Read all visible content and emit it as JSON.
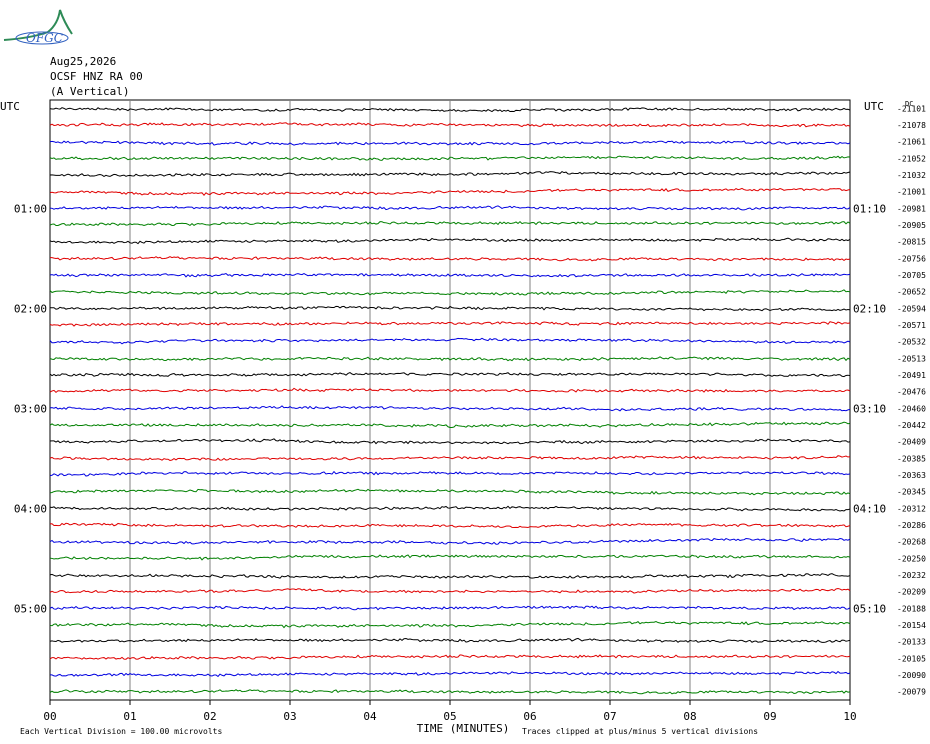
{
  "logo": {
    "text": "OFGC"
  },
  "header": {
    "date": "Aug25,2026",
    "station": "OCSF HNZ RA 00",
    "component": "(A Vertical)"
  },
  "axes": {
    "left_title": "UTC",
    "right_title": "UTC",
    "dc_label": "DC",
    "x_title": "TIME (MINUTES)",
    "x_ticks": [
      "00",
      "01",
      "02",
      "03",
      "04",
      "05",
      "06",
      "07",
      "08",
      "09",
      "10"
    ]
  },
  "footer": {
    "scale_note": "Each Vertical Division =  100.00 microvolts",
    "clip_note": "Traces clipped at plus/minus 5 vertical divisions"
  },
  "colors": {
    "cycle": [
      "#000000",
      "#e00000",
      "#0000e0",
      "#008000"
    ],
    "grid": "#808080"
  },
  "chart_data": {
    "type": "line",
    "title": "OCSF HNZ RA 00 (A Vertical)",
    "xlabel": "TIME (MINUTES)",
    "xlim": [
      0,
      10
    ],
    "left_time_labels": [
      {
        "row": 6,
        "text": "01:00"
      },
      {
        "row": 12,
        "text": "02:00"
      },
      {
        "row": 18,
        "text": "03:00"
      },
      {
        "row": 24,
        "text": "04:00"
      },
      {
        "row": 30,
        "text": "05:00"
      }
    ],
    "right_time_labels": [
      {
        "row": 6,
        "text": "01:10"
      },
      {
        "row": 12,
        "text": "02:10"
      },
      {
        "row": 18,
        "text": "03:10"
      },
      {
        "row": 24,
        "text": "04:10"
      },
      {
        "row": 30,
        "text": "05:10"
      }
    ],
    "dc_offsets": [
      "-21101",
      "-21078",
      "-21061",
      "-21052",
      "-21032",
      "-21001",
      "-20981",
      "-20905",
      "-20815",
      "-20756",
      "-20705",
      "-20652",
      "-20594",
      "-20571",
      "-20532",
      "-20513",
      "-20491",
      "-20476",
      "-20460",
      "-20442",
      "-20409",
      "-20385",
      "-20363",
      "-20345",
      "-20312",
      "-20286",
      "-20268",
      "-20250",
      "-20232",
      "-20209",
      "-20188",
      "-20154",
      "-20133",
      "-20105",
      "-20090",
      "-20079"
    ]
  }
}
